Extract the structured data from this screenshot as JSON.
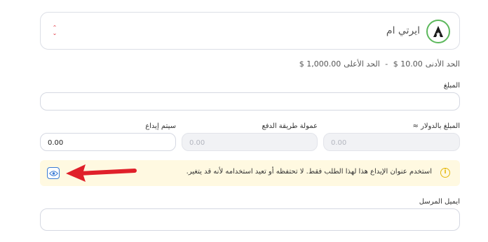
{
  "top_label": "",
  "method": {
    "name": "ايرتي ام",
    "logo_icon": "airtm-logo-icon",
    "arrows_icon": "select-arrows-icon",
    "accent_color": "#5cb85c"
  },
  "limits": {
    "min_label": "الحد الأدنى",
    "min_value": "10.00 $",
    "separator": "-",
    "max_label": "الحد الأعلى",
    "max_value": "1,000.00 $"
  },
  "amount": {
    "label": "المبلغ",
    "value": ""
  },
  "usd_amount": {
    "label": "المبلغ بالدولار ≈",
    "value": "0.00"
  },
  "fee": {
    "label": "عمولة طريقة الدفع",
    "value": "0.00"
  },
  "deposit": {
    "label": "سيتم إيداع",
    "value": "0.00"
  },
  "notice": {
    "text": "استخدم عنوان الإيداع هذا لهذا الطلب فقط. لا تحتفظه أو تعيد استخدامه لأنه قد يتغير.",
    "info_icon": "info-icon",
    "eye_icon": "eye-icon",
    "highlight_color": "#e0202a"
  },
  "sender_email": {
    "label": "ايميل المرسل",
    "value": ""
  }
}
